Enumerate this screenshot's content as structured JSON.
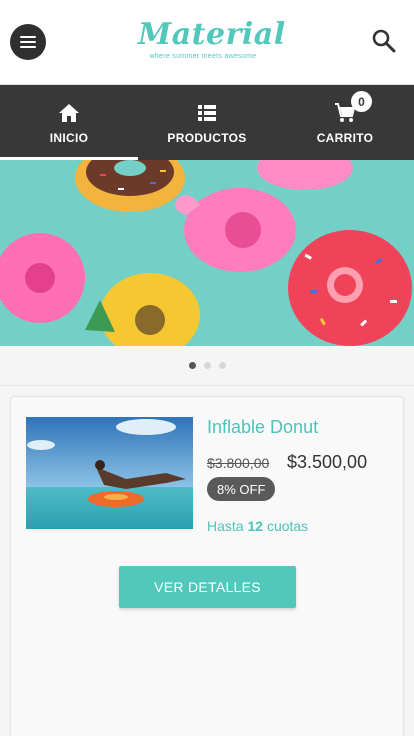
{
  "header": {
    "logo_title": "Material",
    "logo_tagline": "where summer meets awesome",
    "menu_icon": "hamburger-menu-icon",
    "search_icon": "search-icon"
  },
  "nav": {
    "items": [
      {
        "label": "INICIO",
        "icon": "home-icon",
        "active": true
      },
      {
        "label": "PRODUCTOS",
        "icon": "list-icon",
        "active": false
      },
      {
        "label": "CARRITO",
        "icon": "cart-icon",
        "active": false
      }
    ],
    "cart_count": "0"
  },
  "carousel": {
    "slides": 3,
    "active_index": 0
  },
  "product": {
    "name": "Inflable Donut",
    "old_price": "$3.800,00",
    "new_price": "$3.500,00",
    "discount": "8% OFF",
    "installments_prefix": "Hasta",
    "installments_count": "12",
    "installments_suffix": "cuotas",
    "details_button": "VER DETALLES"
  },
  "colors": {
    "accent": "#52c8bd",
    "nav_bg": "#383838"
  }
}
